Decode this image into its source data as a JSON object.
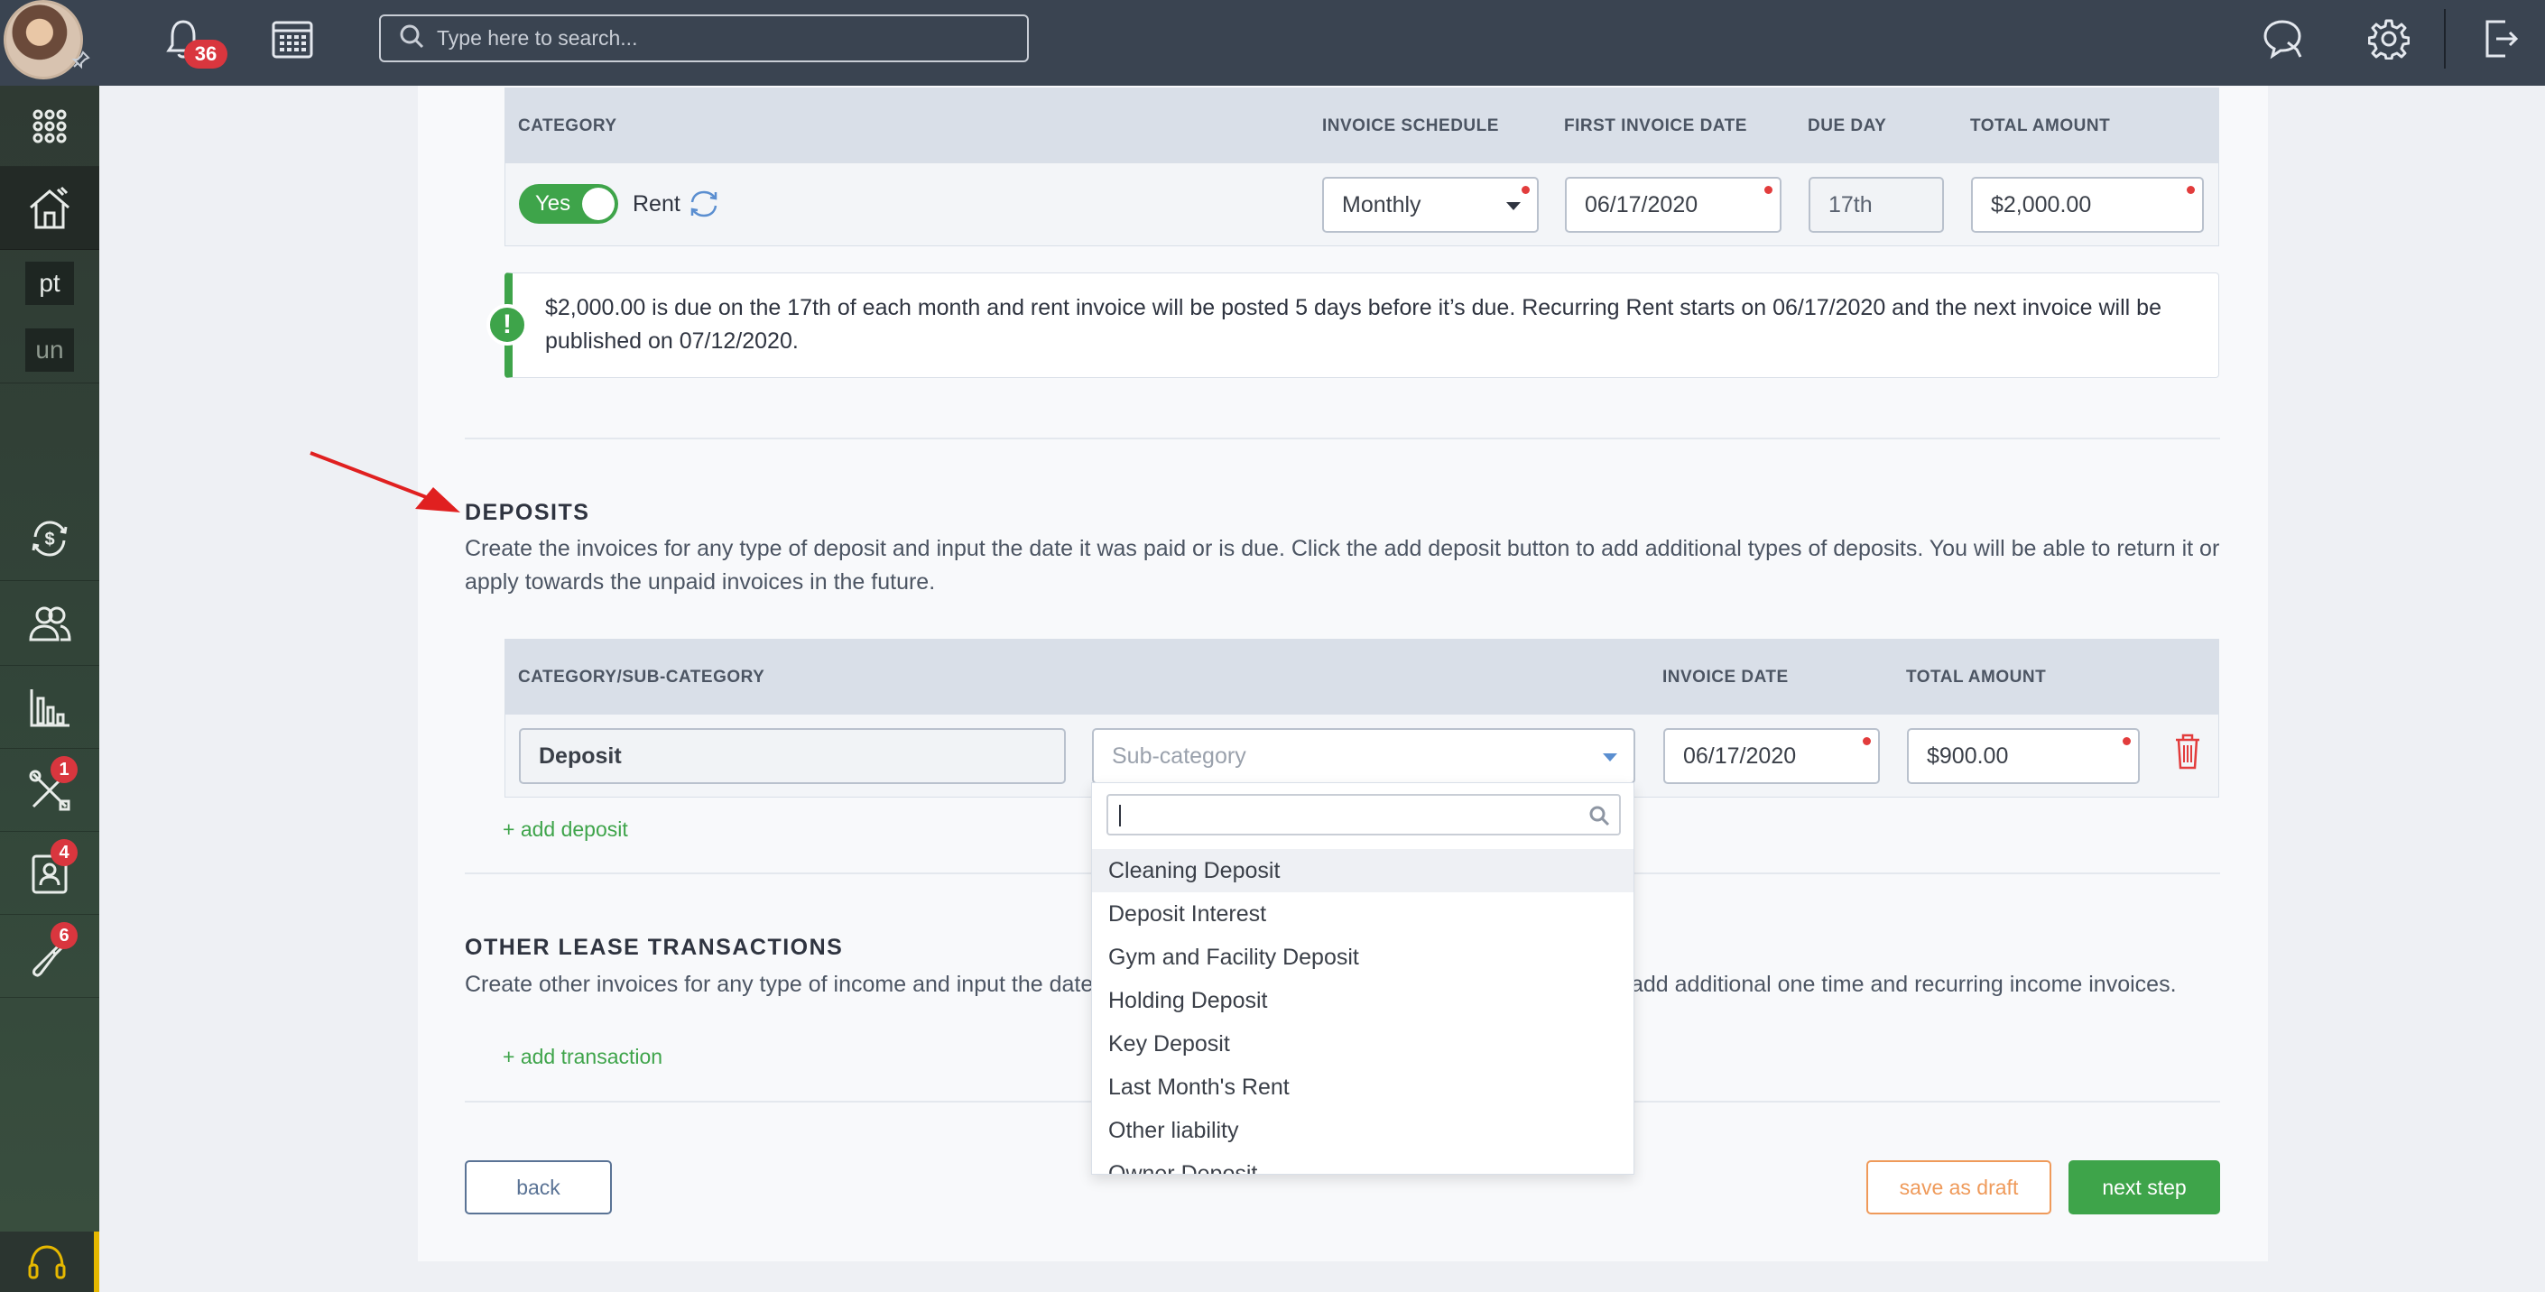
{
  "topbar": {
    "notifications_count": "36",
    "search_placeholder": "Type here to search..."
  },
  "sidebar": {
    "tags": [
      "pt",
      "un"
    ],
    "badges": {
      "tools": "1",
      "contacts": "4",
      "keys": "6"
    }
  },
  "rent": {
    "headers": {
      "category": "CATEGORY",
      "schedule": "INVOICE SCHEDULE",
      "first_date": "FIRST INVOICE DATE",
      "due_day": "DUE DAY",
      "total": "TOTAL AMOUNT"
    },
    "toggle_label": "Yes",
    "category_label": "Rent",
    "schedule_value": "Monthly",
    "first_date_value": "06/17/2020",
    "due_day_value": "17th",
    "total_value": "$2,000.00",
    "notice_text": "$2,000.00 is due on the 17th of each month and rent invoice will be posted 5 days before it’s due. Recurring Rent starts on 06/17/2020 and the next invoice will be published on 07/12/2020."
  },
  "deposits": {
    "title": "DEPOSITS",
    "description": "Create the invoices for any type of deposit and input the date it was paid or is due. Click the add deposit button to add additional types of deposits. You will be able to return it or apply towards the unpaid invoices in the future.",
    "headers": {
      "category": "CATEGORY/SUB-CATEGORY",
      "invoice_date": "INVOICE DATE",
      "total": "TOTAL AMOUNT"
    },
    "category_value": "Deposit",
    "subcategory_placeholder": "Sub-category",
    "invoice_date_value": "06/17/2020",
    "total_value": "$900.00",
    "add_link": "+ add deposit",
    "dropdown_options": [
      "Cleaning Deposit",
      "Deposit Interest",
      "Gym and Facility Deposit",
      "Holding Deposit",
      "Key Deposit",
      "Last Month's Rent",
      "Other liability",
      "Owner Deposit"
    ]
  },
  "other": {
    "title": "OTHER LEASE TRANSACTIONS",
    "description_left": "Create other invoices for any type of income and input the date",
    "description_right": "add additional one time and recurring income invoices.",
    "add_link": "+ add transaction"
  },
  "actions": {
    "back": "back",
    "save_draft": "save as draft",
    "next": "next step"
  },
  "colors": {
    "topbar": "#3a4451",
    "accent_green": "#3ea44a",
    "draft_orange": "#ef9a5a",
    "required_red": "#e23c3c"
  }
}
